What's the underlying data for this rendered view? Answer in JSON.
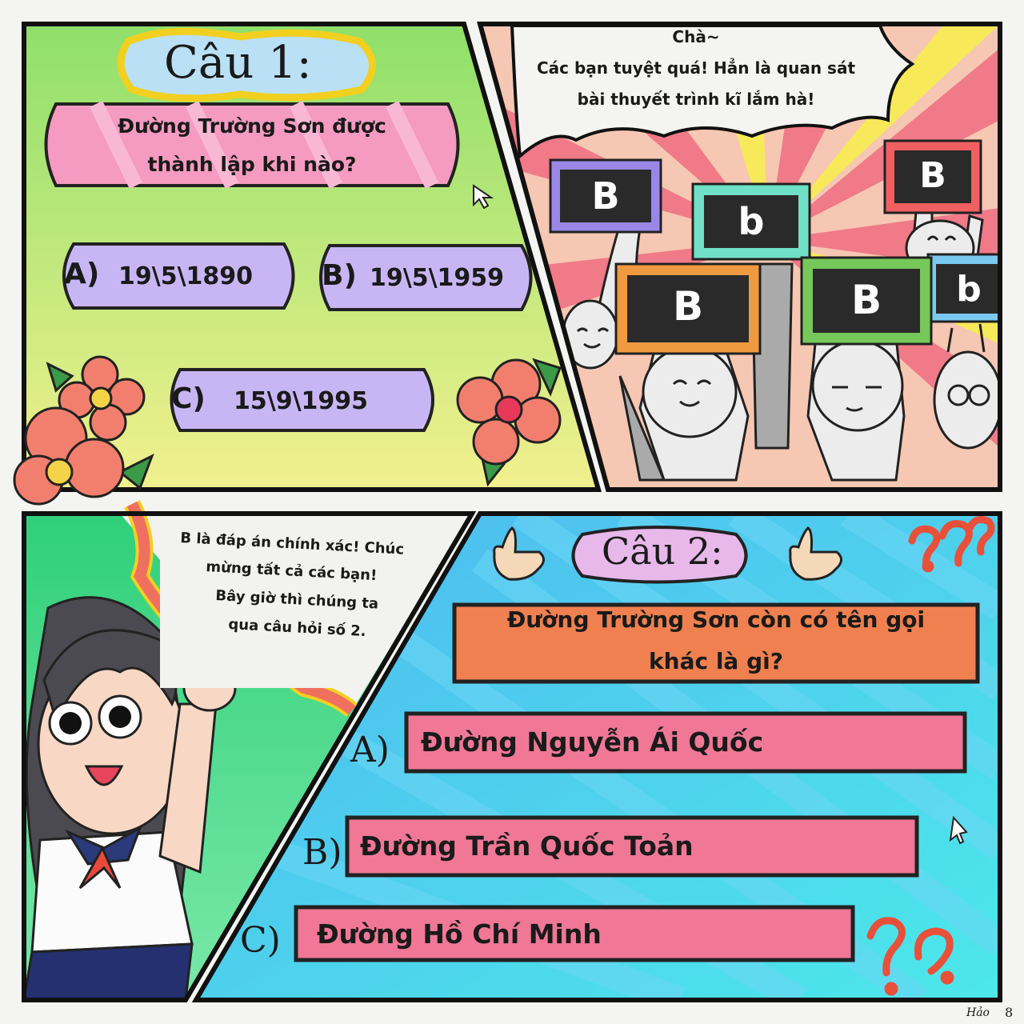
{
  "page": {
    "signature": "Hảo",
    "page_number": "8"
  },
  "panel1": {
    "title": "Câu 1:",
    "question_line1": "Đường Trường Sơn được",
    "question_line2": "thành lập khi nào?",
    "options": [
      {
        "letter": "A)",
        "text": "19\\5\\1890"
      },
      {
        "letter": "B)",
        "text": "19\\5\\1959"
      },
      {
        "letter": "C)",
        "text": "15\\9\\1995"
      }
    ]
  },
  "panel2": {
    "speech_line1": "Chà~",
    "speech_line2": "Các bạn tuyệt quá! Hẳn là quan sát",
    "speech_line3": "bài thuyết trình kĩ lắm hà!",
    "signs": [
      "B",
      "b",
      "B",
      "B",
      "B",
      "b"
    ]
  },
  "panel3": {
    "speech_line1": "B là đáp án chính xác! Chúc",
    "speech_line2": "mừng tất cả các bạn!",
    "speech_line3": "Bây giờ thì chúng ta",
    "speech_line4": "qua câu hỏi số 2."
  },
  "panel4": {
    "title": "Câu 2:",
    "question_line1": "Đường Trường Sơn còn có tên gọi",
    "question_line2": "khác là gì?",
    "options": [
      {
        "letter": "A)",
        "text": "Đường Nguyễn Ái Quốc"
      },
      {
        "letter": "B)",
        "text": "Đường Trần Quốc Toản"
      },
      {
        "letter": "C)",
        "text": "Đường Hồ Chí Minh"
      }
    ]
  },
  "colors": {
    "panel1_bg_top": "#8ee06a",
    "panel1_bg_bottom": "#f2f08e",
    "question_pink": "#f59ac0",
    "option_purple": "#c8b6f4",
    "panel4_bg": "#46c8ee",
    "option_pink": "#f07896",
    "question_orange": "#f08050"
  }
}
